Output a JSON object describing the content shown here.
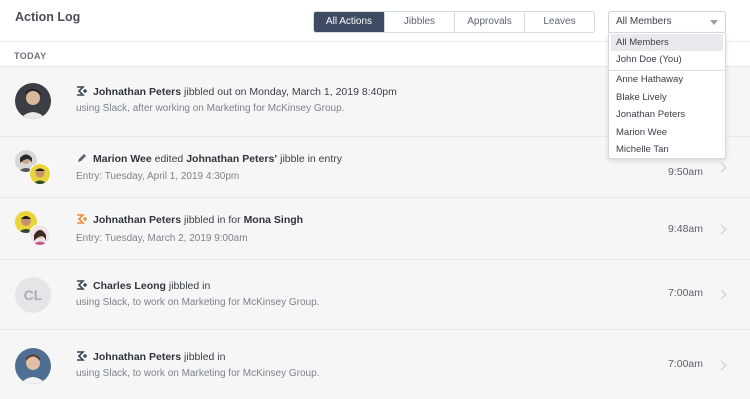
{
  "header": {
    "title": "Action Log"
  },
  "filter_tabs": [
    {
      "label": "All Actions",
      "active": true
    },
    {
      "label": "Jibbles",
      "active": false
    },
    {
      "label": "Approvals",
      "active": false
    },
    {
      "label": "Leaves",
      "active": false
    }
  ],
  "member_select": {
    "value": "All Members",
    "options": [
      "All Members",
      "John Doe (You)",
      "Anne Hathaway",
      "Blake Lively",
      "Jonathan Peters",
      "Marion Wee",
      "Michelle Tan"
    ],
    "highlighted": "All Members"
  },
  "section_label": "TODAY",
  "entries": [
    {
      "actor": "Johnathan Peters",
      "action": " jibbled out on Monday, March 1, 2019 8:40pm",
      "detail": "using Slack, after working on Marketing for McKinsey Group.",
      "time": "",
      "icon": "jibble-out-icon"
    },
    {
      "actor": "Marion Wee",
      "action_pre": " edited ",
      "target": "Johnathan Peters’",
      "action_post": " jibble in entry",
      "detail": "Entry: Tuesday, April 1, 2019 4:30pm",
      "time": "9:50am",
      "icon": "pencil-icon"
    },
    {
      "actor": "Johnathan Peters",
      "action_pre": " jibbled in for ",
      "target": "Mona Singh",
      "detail": "Entry: Tuesday, March 2, 2019 9:00am",
      "time": "9:48am",
      "icon": "jibble-in-for-icon"
    },
    {
      "actor": "Charles Leong",
      "action": " jibbled in",
      "detail": "using Slack, to work on Marketing for McKinsey Group.",
      "time": "7:00am",
      "icon": "jibble-in-icon",
      "initials": "CL"
    },
    {
      "actor": "Johnathan Peters",
      "action": " jibbled in",
      "detail": "using Slack, to work on Marketing for McKinsey Group.",
      "time": "7:00am",
      "icon": "jibble-in-icon"
    }
  ],
  "colors": {
    "accent": "#3d4b63",
    "row_bg": "#f6f6f7",
    "jibble_orange": "#f08a3c",
    "icon_dark": "#3a4559"
  }
}
